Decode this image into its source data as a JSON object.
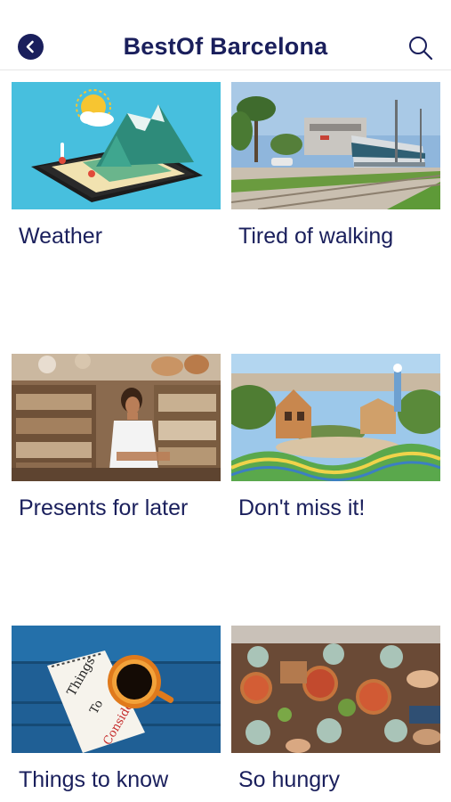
{
  "header": {
    "title": "BestOf Barcelona",
    "back_icon": "chevron-left-icon",
    "search_icon": "search-icon"
  },
  "colors": {
    "primary": "#1a1f5c",
    "divider": "#e6e6e6",
    "background": "#ffffff"
  },
  "categories": [
    {
      "label": "Weather",
      "image": "weather-illustration"
    },
    {
      "label": "Tired of walking",
      "image": "tram-photo"
    },
    {
      "label": "Presents for later",
      "image": "market-shop-photo"
    },
    {
      "label": "Don't miss it!",
      "image": "park-guell-photo"
    },
    {
      "label": "Things to know",
      "image": "coffee-note-photo"
    },
    {
      "label": "So hungry",
      "image": "food-table-photo"
    }
  ]
}
